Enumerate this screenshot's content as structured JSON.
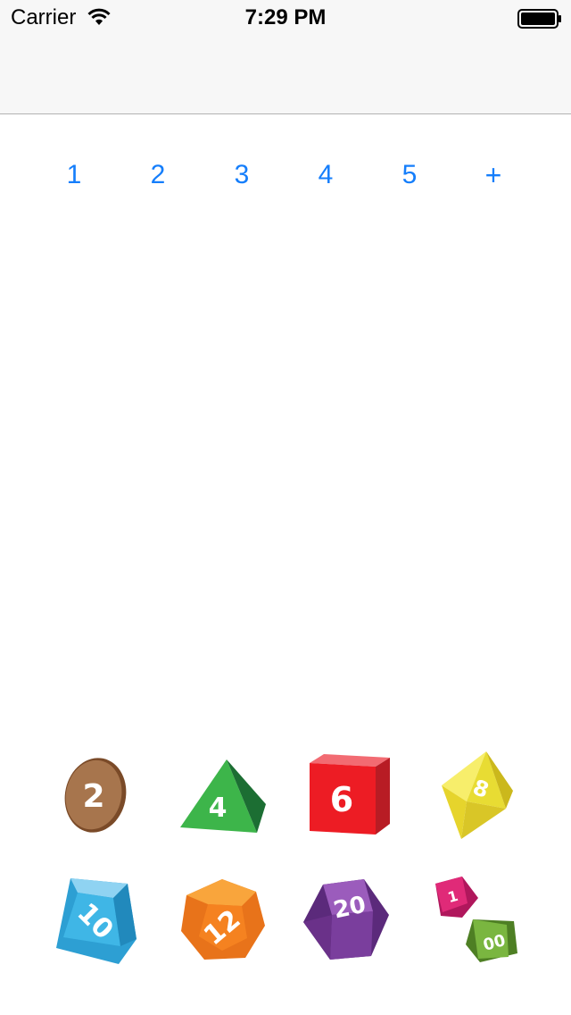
{
  "status": {
    "carrier": "Carrier",
    "time": "7:29 PM"
  },
  "count_selector": [
    {
      "label": "1"
    },
    {
      "label": "2"
    },
    {
      "label": "3"
    },
    {
      "label": "4"
    },
    {
      "label": "5"
    },
    {
      "label": "+"
    }
  ],
  "dice": [
    {
      "label": "2",
      "sides": "d2",
      "color": "#a7754d"
    },
    {
      "label": "4",
      "sides": "d4",
      "color": "#3db54a"
    },
    {
      "label": "6",
      "sides": "d6",
      "color": "#ed1c24"
    },
    {
      "label": "8",
      "sides": "d8",
      "color": "#f2e33b"
    },
    {
      "label": "10",
      "sides": "d10",
      "color": "#3fb6e6"
    },
    {
      "label": "12",
      "sides": "d12",
      "color": "#f58220"
    },
    {
      "label": "20",
      "sides": "d20",
      "color": "#7a3e9d"
    },
    {
      "label": "1",
      "sides": "d100-tens",
      "color": "#e02a78"
    },
    {
      "label": "00",
      "sides": "d100-ones",
      "color": "#7ab640"
    }
  ],
  "colors": {
    "accent": "#157efb",
    "nav_background": "#f7f7f7"
  }
}
